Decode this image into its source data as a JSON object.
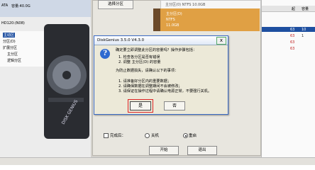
{
  "left_panel": {
    "interface_label": "ATA",
    "capacity_label": "容量:40.0G",
    "disk_label": "HD120:(N08)",
    "tree_items": [
      "主动区",
      "分区(D)",
      "扩展分区",
      "主分区",
      "逻辑分区"
    ]
  },
  "toolbar": {
    "select_partition": "选择分区",
    "partition_info": "主分区(0) NTFS 10.0GB"
  },
  "partition_bar": {
    "line1": "主分区(D)",
    "line2": "NTFS",
    "line3": "11.0GB"
  },
  "right_table": {
    "headers": [
      "起",
      "容量"
    ],
    "rows": [
      {
        "c1": "63",
        "c2": "10"
      },
      {
        "c1": "63",
        "c2": "1"
      },
      {
        "c1": "63",
        "c2": ""
      },
      {
        "c1": "63",
        "c2": ""
      }
    ]
  },
  "dialog": {
    "title": "DiskGenius 3.5.0 V4.3.0",
    "close": "x",
    "icon": "question-icon",
    "lines": [
      "确定要立即调整此分区的容量吗？操作步骤包括：",
      "1. 检查各分区是否有错误",
      "2. 调整 主分区(D) 的容量",
      "",
      "为防止数据损失，请确认以下的事项：",
      "",
      "1. 请准备好分区内的重要数据；",
      "2. 请确保数据在调整期间不会被修改；",
      "3. 请保证在操作过程中请确认电源正常，不要强行关机。"
    ],
    "yes_label": "是",
    "no_label": "否"
  },
  "options": {
    "complete_label": "完成后：",
    "shutdown_label": "关机",
    "restart_label": "重启",
    "selected": "重启"
  },
  "buttons": {
    "start_label": "开始",
    "exit_label": "退出"
  },
  "colors": {
    "partition_bar": "#e0a044",
    "dialog_border": "#3b6bc7",
    "focus_highlight": "#dd2222"
  }
}
